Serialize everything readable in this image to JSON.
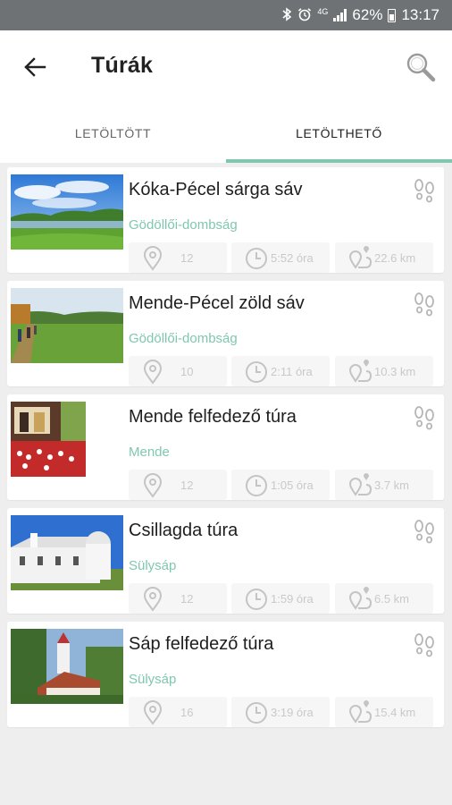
{
  "statusbar": {
    "network": "4G",
    "battery": "62%",
    "time": "13:17"
  },
  "appbar": {
    "title": "Túrák"
  },
  "tabs": [
    {
      "label": "LETÖLTÖTT"
    },
    {
      "label": "LETÖLTHETŐ"
    }
  ],
  "colors": {
    "accent": "#7fc7b0",
    "statusbar": "#6f7274"
  },
  "tours": [
    {
      "title": "Kóka-Pécel sárga sáv",
      "region": "Gödöllői-dombság",
      "points": "12",
      "duration": "5:52 óra",
      "distance": "22.6 km"
    },
    {
      "title": "Mende-Pécel zöld sáv",
      "region": "Gödöllői-dombság",
      "points": "10",
      "duration": "2:11 óra",
      "distance": "10.3 km"
    },
    {
      "title": "Mende felfedező túra",
      "region": "Mende",
      "points": "12",
      "duration": "1:05 óra",
      "distance": "3.7 km"
    },
    {
      "title": "Csillagda túra",
      "region": "Sülysáp",
      "points": "12",
      "duration": "1:59 óra",
      "distance": "6.5 km"
    },
    {
      "title": "Sáp felfedező túra",
      "region": "Sülysáp",
      "points": "16",
      "duration": "3:19 óra",
      "distance": "15.4 km"
    }
  ]
}
